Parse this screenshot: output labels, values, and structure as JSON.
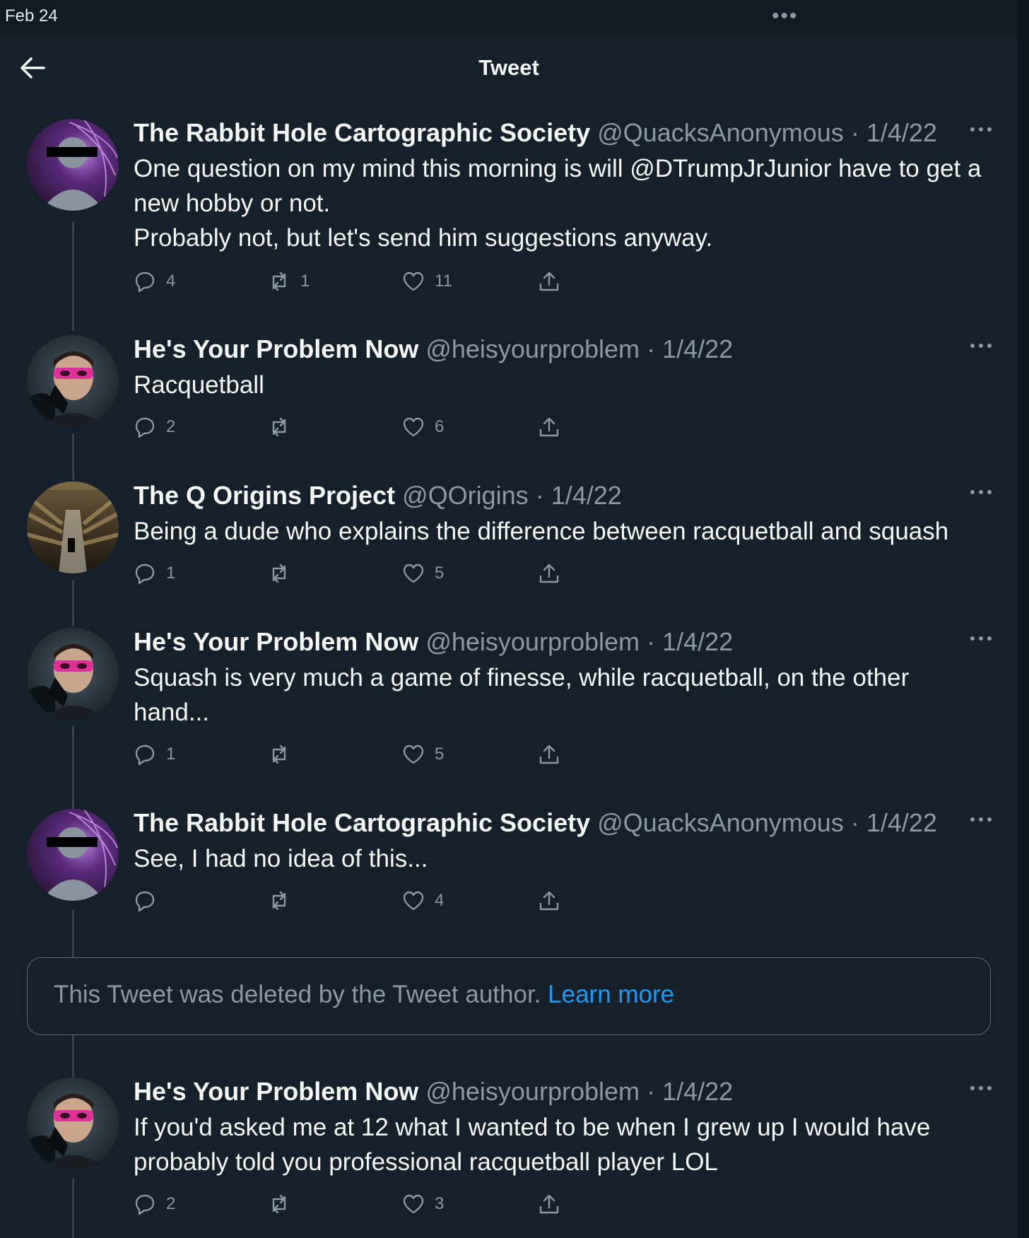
{
  "status": {
    "date": "Feb 24",
    "dots": "•••"
  },
  "header": {
    "title": "Tweet"
  },
  "tweets": [
    {
      "avatar": "avatar-rabbit-hole",
      "name": "The Rabbit Hole Cartographic Society",
      "handle": "@QuacksAnonymous",
      "sep": "·",
      "date": "1/4/22",
      "text": "One question on my mind this morning is will @DTrumpJrJunior have to get a new hobby or not.\nProbably not, but let's send him suggestions anyway.",
      "replies": "4",
      "retweets": "1",
      "likes": "11"
    },
    {
      "avatar": "avatar-masked-man",
      "name": "He's Your Problem Now",
      "handle": "@heisyourproblem",
      "sep": "·",
      "date": "1/4/22",
      "text": "Racquetball",
      "replies": "2",
      "retweets": "",
      "likes": "6"
    },
    {
      "avatar": "avatar-maze",
      "name": "The Q Origins Project",
      "handle": "@QOrigins",
      "sep": "·",
      "date": "1/4/22",
      "text": "Being a dude who explains the difference between racquetball and squash",
      "replies": "1",
      "retweets": "",
      "likes": "5"
    },
    {
      "avatar": "avatar-masked-man",
      "name": "He's Your Problem Now",
      "handle": "@heisyourproblem",
      "sep": "·",
      "date": "1/4/22",
      "text": "Squash is very much a game of finesse, while racquetball, on the other hand...",
      "replies": "1",
      "retweets": "",
      "likes": "5"
    },
    {
      "avatar": "avatar-rabbit-hole",
      "name": "The Rabbit Hole Cartographic Society",
      "handle": "@QuacksAnonymous",
      "sep": "·",
      "date": "1/4/22",
      "text": "See, I had no idea of this...",
      "replies": "",
      "retweets": "",
      "likes": "4"
    },
    {
      "avatar": "avatar-masked-man",
      "name": "He's Your Problem Now",
      "handle": "@heisyourproblem",
      "sep": "·",
      "date": "1/4/22",
      "text": "If you'd asked me at 12 what I wanted to be when I grew up I would have probably told you professional racquetball player LOL",
      "replies": "2",
      "retweets": "",
      "likes": "3"
    }
  ],
  "deleted": {
    "text": "This Tweet was deleted by the Tweet author.",
    "link": "Learn more"
  },
  "colors": {
    "background": "#15202b",
    "text": "#f7f9f9",
    "secondary": "#8b98a5",
    "link": "#1d9bf0",
    "thread_line": "#38444d"
  }
}
